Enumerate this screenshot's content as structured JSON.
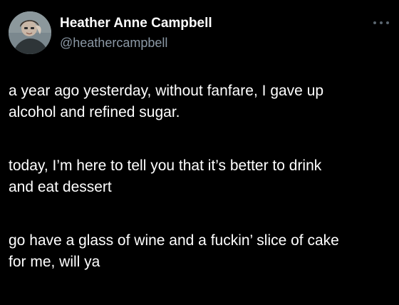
{
  "author": {
    "display_name": "Heather Anne Campbell",
    "handle": "@heathercampbell",
    "avatar_icon": "profile-photo"
  },
  "menu": {
    "icon": "more-options-icon"
  },
  "tweet": {
    "paragraphs": [
      [
        "a year ago yesterday, without fanfare, I gave up",
        "alcohol and refined sugar."
      ],
      [
        "today, I’m here to tell you that it’s better to drink",
        "and eat dessert"
      ],
      [
        "go have a glass of wine and a fuckin’ slice of cake",
        "for me, will ya"
      ]
    ]
  },
  "colors": {
    "background": "#000000",
    "text": "#ffffff",
    "secondary_text": "#8b98a5"
  }
}
